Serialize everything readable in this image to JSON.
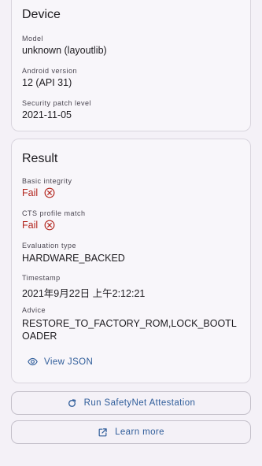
{
  "device": {
    "title": "Device",
    "model_label": "Model",
    "model_value": "unknown (layoutlib)",
    "android_label": "Android version",
    "android_value": "12 (API 31)",
    "patch_label": "Security patch level",
    "patch_value": "2021-11-05"
  },
  "result": {
    "title": "Result",
    "basic_label": "Basic integrity",
    "basic_value": "Fail",
    "cts_label": "CTS profile match",
    "cts_value": "Fail",
    "eval_label": "Evaluation type",
    "eval_value": "HARDWARE_BACKED",
    "timestamp_label": "Timestamp",
    "timestamp_value": "2021年9月22日 上午2:12:21",
    "advice_label": "Advice",
    "advice_value": "RESTORE_TO_FACTORY_ROM,LOCK_BOOTLOADER",
    "view_json_label": "View JSON"
  },
  "actions": {
    "run_label": "Run SafetyNet Attestation",
    "learn_label": "Learn more"
  },
  "icons": {
    "fail": "cancel-circle-icon",
    "view_json": "eye-icon",
    "run": "refresh-icon",
    "learn": "open-in-new-icon"
  },
  "colors": {
    "background": "#f4f1f7",
    "fail": "#b3261e",
    "accent": "#2f5d9a"
  }
}
